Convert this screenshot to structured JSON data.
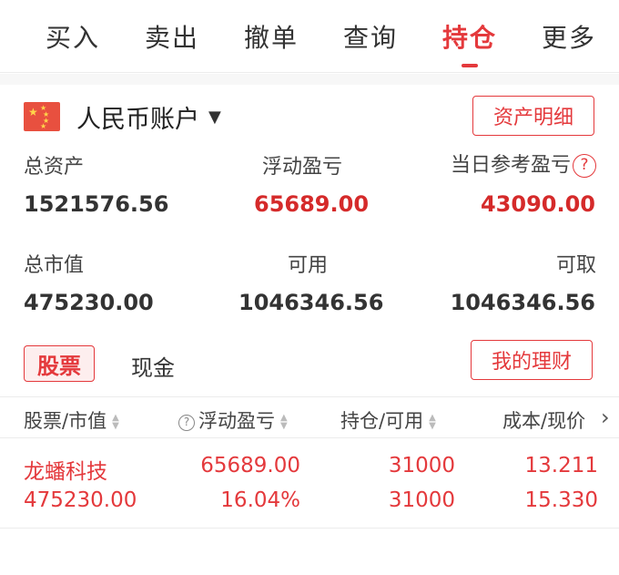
{
  "tabs": [
    {
      "label": "买入",
      "active": false
    },
    {
      "label": "卖出",
      "active": false
    },
    {
      "label": "撤单",
      "active": false
    },
    {
      "label": "查询",
      "active": false
    },
    {
      "label": "持仓",
      "active": true
    },
    {
      "label": "更多",
      "active": false
    }
  ],
  "account": {
    "name": "人民币账户",
    "caret": "▼",
    "detail_button": "资产明细"
  },
  "summary": {
    "total_assets": {
      "label": "总资产",
      "value": "1521576.56"
    },
    "floating_pnl": {
      "label": "浮动盈亏",
      "value": "65689.00"
    },
    "daily_pnl": {
      "label": "当日参考盈亏",
      "value": "43090.00"
    },
    "market_value": {
      "label": "总市值",
      "value": "475230.00"
    },
    "available": {
      "label": "可用",
      "value": "1046346.56"
    },
    "withdrawable": {
      "label": "可取",
      "value": "1046346.56"
    }
  },
  "segments": {
    "stock": "股票",
    "cash": "现金",
    "finance_button": "我的理财"
  },
  "table": {
    "headers": [
      "股票/市值",
      "浮动盈亏",
      "持仓/可用",
      "成本/现价"
    ],
    "rows": [
      {
        "name": "龙蟠科技",
        "market_value": "475230.00",
        "pnl": "65689.00",
        "pnl_pct": "16.04%",
        "position": "31000",
        "available": "31000",
        "cost": "13.211",
        "price": "15.330"
      }
    ]
  },
  "colors": {
    "accent": "#e4393c",
    "gain": "#d52a2a",
    "flag": "#e8503f"
  },
  "icons": {
    "help": "question-circle-icon",
    "sort": "sort-arrows-icon",
    "more": "chevron-right-icon"
  }
}
